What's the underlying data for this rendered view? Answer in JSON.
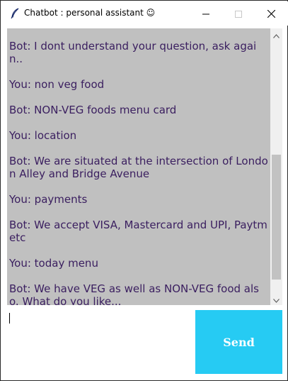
{
  "window": {
    "title": "Chatbot : personal assistant ☺"
  },
  "chat": {
    "messages": [
      "Bot: I dont understand your question, ask again..",
      "You: non veg food",
      "Bot: NON-VEG foods menu card",
      "You: location",
      "Bot: We are situated at the intersection of London Alley and Bridge Avenue",
      "You: payments",
      "Bot: We accept VISA, Mastercard and UPI, Paytm etc",
      "You: today menu",
      "Bot: We have VEG as well as NON-VEG food also. What do you like..."
    ],
    "text_color": "#3a1e5f",
    "background": "#c0c0c0"
  },
  "input": {
    "value": ""
  },
  "send": {
    "label": "Send",
    "color": "#26cbf3"
  },
  "icons": {
    "app": "feather-icon",
    "minimize": "minimize-icon",
    "maximize": "maximize-icon",
    "close": "close-icon",
    "scroll_up": "chevron-up-icon",
    "scroll_down": "chevron-down-icon"
  }
}
